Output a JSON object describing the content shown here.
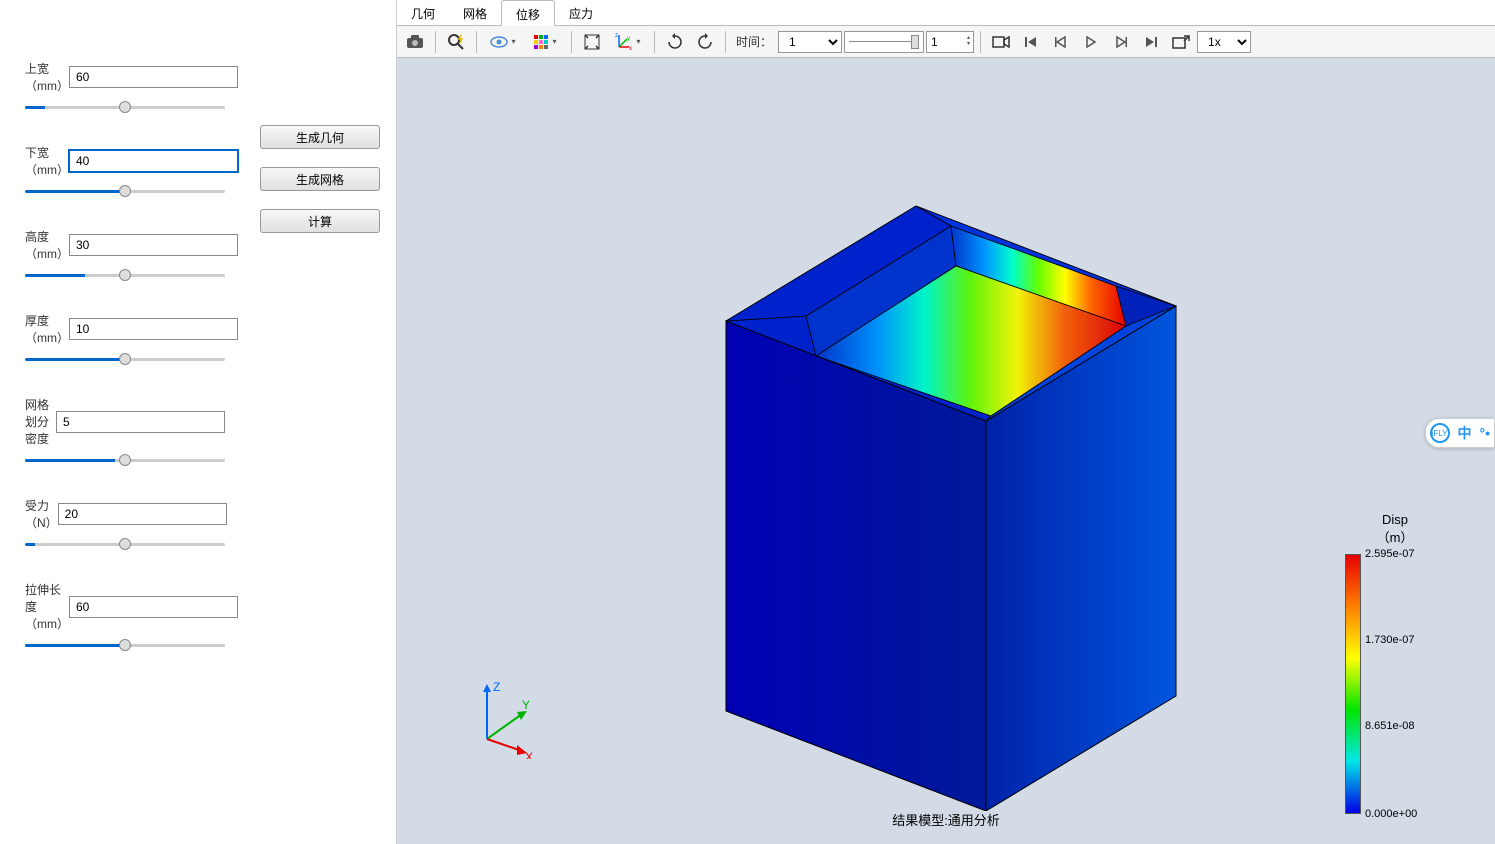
{
  "params": [
    {
      "label": "上宽（mm）",
      "value": "60",
      "pct": "10%",
      "wide": false,
      "active": false
    },
    {
      "label": "下宽（mm）",
      "value": "40",
      "pct": "50%",
      "wide": false,
      "active": true
    },
    {
      "label": "高度（mm）",
      "value": "30",
      "pct": "30%",
      "wide": false,
      "active": false
    },
    {
      "label": "厚度（mm）",
      "value": "10",
      "pct": "50%",
      "wide": false,
      "active": false
    },
    {
      "label": "网格划分密度",
      "value": "5",
      "pct": "45%",
      "wide": false,
      "active": false
    },
    {
      "label": "受力（N）",
      "value": "20",
      "pct": "5%",
      "wide": false,
      "active": false
    },
    {
      "label": "拉伸长度（mm）",
      "value": "60",
      "pct": "50%",
      "wide": true,
      "active": false
    }
  ],
  "actions": {
    "geom": "生成几何",
    "mesh": "生成网格",
    "calc": "计算"
  },
  "tabs": [
    {
      "label": "几何",
      "active": false
    },
    {
      "label": "网格",
      "active": false
    },
    {
      "label": "位移",
      "active": true
    },
    {
      "label": "应力",
      "active": false
    }
  ],
  "toolbar": {
    "time_label": "时间：",
    "time_value": "1",
    "spin_value": "1",
    "speed_value": "1x"
  },
  "legend": {
    "title": "Disp",
    "unit": "（m）",
    "ticks": [
      {
        "pos": "0%",
        "val": "2.595e-07"
      },
      {
        "pos": "33%",
        "val": "1.730e-07"
      },
      {
        "pos": "66%",
        "val": "8.651e-08"
      },
      {
        "pos": "100%",
        "val": "0.000e+00"
      }
    ]
  },
  "axis": {
    "x": "X",
    "y": "Y",
    "z": "Z"
  },
  "result_label": "结果模型:通用分析",
  "ime": {
    "lang": "中"
  }
}
